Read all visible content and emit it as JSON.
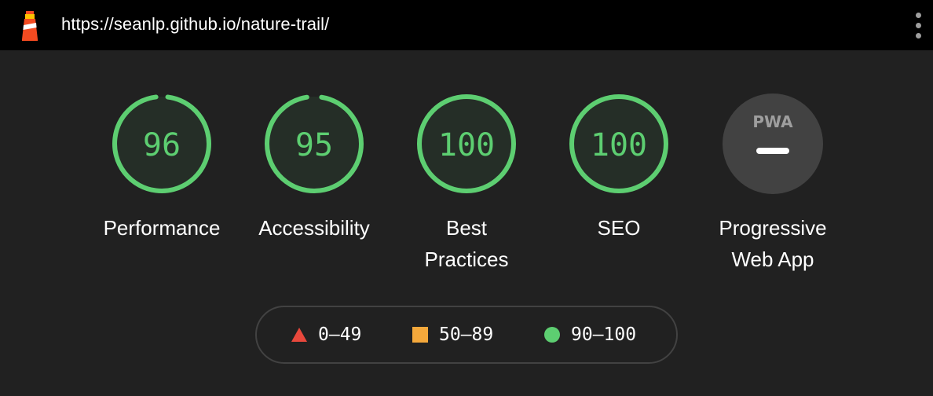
{
  "browser": {
    "url": "https://seanlp.github.io/nature-trail/",
    "menu_icon": "more-vert-icon",
    "logo_icon": "lighthouse-icon"
  },
  "gauges": [
    {
      "label": "Performance",
      "label_line2": "",
      "score": "96",
      "fraction": 0.96,
      "color": "#5dce71"
    },
    {
      "label": "Accessibility",
      "label_line2": "",
      "score": "95",
      "fraction": 0.95,
      "color": "#5dce71"
    },
    {
      "label": "Best",
      "label_line2": "Practices",
      "score": "100",
      "fraction": 1.0,
      "color": "#5dce71"
    },
    {
      "label": "SEO",
      "label_line2": "",
      "score": "100",
      "fraction": 1.0,
      "color": "#5dce71"
    },
    {
      "label": "Progressive",
      "label_line2": "Web App",
      "badge": "PWA",
      "badge_icon": "pwa-dash-icon"
    }
  ],
  "legend": [
    {
      "range": "0–49",
      "shape": "triangle",
      "color": "#e8483c"
    },
    {
      "range": "50–89",
      "shape": "square",
      "color": "#f4a83b"
    },
    {
      "range": "90–100",
      "shape": "circle",
      "color": "#5dce71"
    }
  ],
  "colors": {
    "background": "#212121",
    "topbar": "#000000",
    "pass": "#5dce71",
    "pwa_fill": "#424242"
  }
}
